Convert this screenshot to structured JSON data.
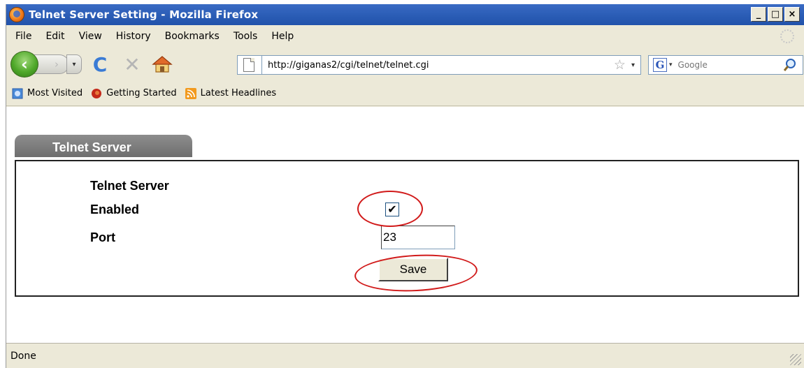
{
  "window": {
    "title": "Telnet Server Setting - Mozilla Firefox",
    "minimize": "_",
    "maximize": "□",
    "close": "×"
  },
  "menu": [
    "File",
    "Edit",
    "View",
    "History",
    "Bookmarks",
    "Tools",
    "Help"
  ],
  "nav": {
    "back_glyph": "‹",
    "forward_glyph": "›",
    "dropdown_glyph": "▾",
    "reload_glyph": "C",
    "stop_glyph": "✕",
    "url": "http://giganas2/cgi/telnet/telnet.cgi",
    "star_glyph": "☆"
  },
  "search": {
    "engine_letter": "G",
    "placeholder": "Google"
  },
  "bookmarks": [
    {
      "label": "Most Visited",
      "icon": "most-visited-icon"
    },
    {
      "label": "Getting Started",
      "icon": "firefox-icon"
    },
    {
      "label": "Latest Headlines",
      "icon": "rss-icon"
    }
  ],
  "page": {
    "tab_label": "Telnet Server",
    "section_title": "Telnet Server",
    "enabled_label": "Enabled",
    "enabled_checked": true,
    "check_glyph": "✔",
    "port_label": "Port",
    "port_value": "23",
    "save_label": "Save"
  },
  "status": {
    "text": "Done"
  },
  "colors": {
    "titlebar": "#2d5fb8",
    "annotation": "#d11a1a",
    "chrome": "#ece9d8",
    "tab": "#7a7a7a"
  }
}
